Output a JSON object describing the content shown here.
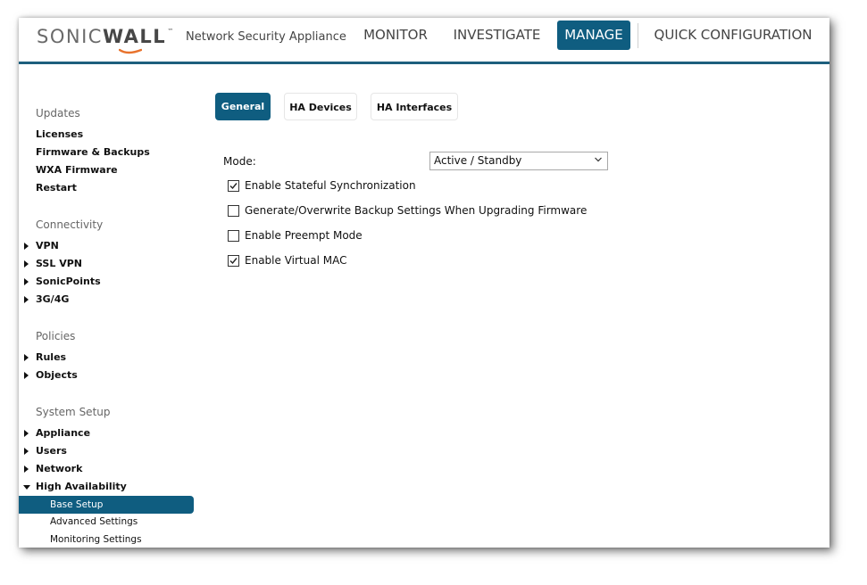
{
  "header": {
    "logo_part1": "SONIC",
    "logo_part2": "WALL",
    "logo_tm": "™",
    "product": "Network Security Appliance",
    "nav": [
      {
        "label": "MONITOR",
        "active": false
      },
      {
        "label": "INVESTIGATE",
        "active": false
      },
      {
        "label": "MANAGE",
        "active": true
      },
      {
        "label": "QUICK CONFIGURATION",
        "active": false
      }
    ]
  },
  "sidebar": {
    "updates": {
      "title": "Updates",
      "items": [
        "Licenses",
        "Firmware & Backups",
        "WXA Firmware",
        "Restart"
      ]
    },
    "connectivity": {
      "title": "Connectivity",
      "items": [
        "VPN",
        "SSL VPN",
        "SonicPoints",
        "3G/4G"
      ]
    },
    "policies": {
      "title": "Policies",
      "items": [
        "Rules",
        "Objects"
      ]
    },
    "system_setup": {
      "title": "System Setup",
      "items": [
        "Appliance",
        "Users",
        "Network",
        "High Availability"
      ],
      "ha_subitems": [
        "Base Setup",
        "Advanced Settings",
        "Monitoring Settings"
      ],
      "active_subitem": "Base Setup"
    }
  },
  "tabs": [
    {
      "label": "General",
      "active": true
    },
    {
      "label": "HA Devices",
      "active": false
    },
    {
      "label": "HA Interfaces",
      "active": false
    }
  ],
  "form": {
    "mode_label": "Mode:",
    "mode_value": "Active / Standby",
    "checkboxes": [
      {
        "label": "Enable Stateful Synchronization",
        "checked": true
      },
      {
        "label": "Generate/Overwrite Backup Settings When Upgrading Firmware",
        "checked": false
      },
      {
        "label": "Enable Preempt Mode",
        "checked": false
      },
      {
        "label": "Enable Virtual MAC",
        "checked": true
      }
    ]
  },
  "colors": {
    "accent": "#0f5d80",
    "header_line": "#1d5f7d",
    "logo_swoosh": "#e8722c"
  }
}
